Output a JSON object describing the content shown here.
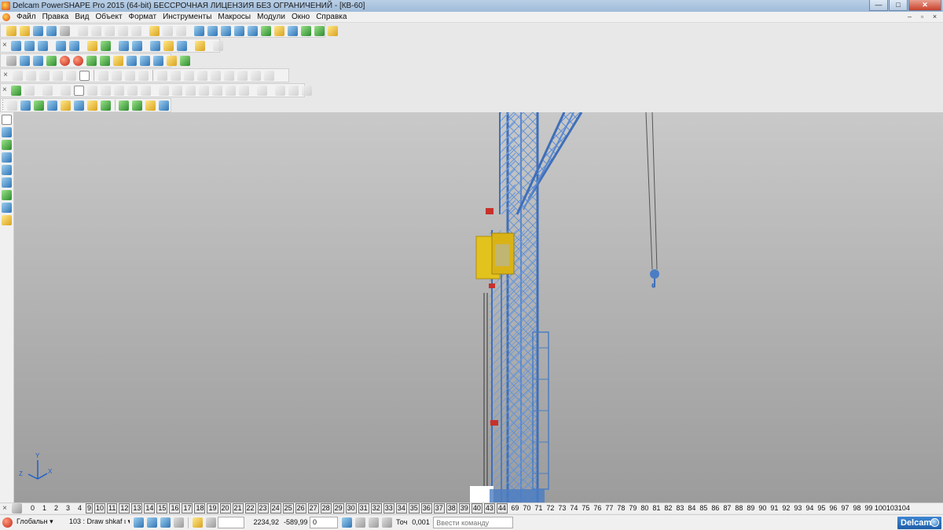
{
  "window": {
    "title": "Delcam PowerSHAPE Pro 2015 (64-bit) БЕССРОЧНАЯ ЛИЦЕНЗИЯ БЕЗ ОГРАНИЧЕНИЙ - [КВ-60]",
    "minimize": "—",
    "maximize": "□",
    "close": "✕"
  },
  "menu": {
    "items": [
      "Файл",
      "Правка",
      "Вид",
      "Объект",
      "Формат",
      "Инструменты",
      "Макросы",
      "Модули",
      "Окно",
      "Справка"
    ],
    "mdi_minimize": "–",
    "mdi_restore": "▫",
    "mdi_close": "×"
  },
  "levels": {
    "boxed": [
      "9",
      "10",
      "11",
      "12",
      "13",
      "14",
      "15",
      "16",
      "17",
      "18",
      "19",
      "20",
      "21",
      "22",
      "23",
      "24",
      "25",
      "26",
      "27",
      "28",
      "29",
      "30",
      "31",
      "32",
      "33",
      "34",
      "35",
      "36",
      "37",
      "38",
      "39",
      "40",
      "43",
      "44"
    ],
    "plain_before": [
      "0",
      "1",
      "2",
      "3",
      "4"
    ],
    "plain_after": [
      "69",
      "70",
      "71",
      "72",
      "73",
      "74",
      "75",
      "76",
      "77",
      "78",
      "79",
      "80",
      "81",
      "82",
      "83",
      "84",
      "85",
      "86",
      "87",
      "88",
      "89",
      "90",
      "91",
      "92",
      "93",
      "94",
      "95",
      "96",
      "97",
      "98",
      "99",
      "100",
      "103",
      "104"
    ]
  },
  "status": {
    "workplane": "Глобальн ▾",
    "level_select": "103 : Draw shkaf ι ▾",
    "coord_x": "2234,92",
    "coord_y": "-589,99",
    "coord_z": "0",
    "tolerance_label": "Точ",
    "tolerance_value": "0,001",
    "command_placeholder": "Ввести команду",
    "brand": "Delcam"
  },
  "axis_triad": {
    "y": "Y",
    "z": "Z",
    "x": "X"
  },
  "colors": {
    "crane_blue": "#4a7dc4",
    "cabin_yellow": "#e2c21d",
    "titlebar": "#a9c3df"
  }
}
